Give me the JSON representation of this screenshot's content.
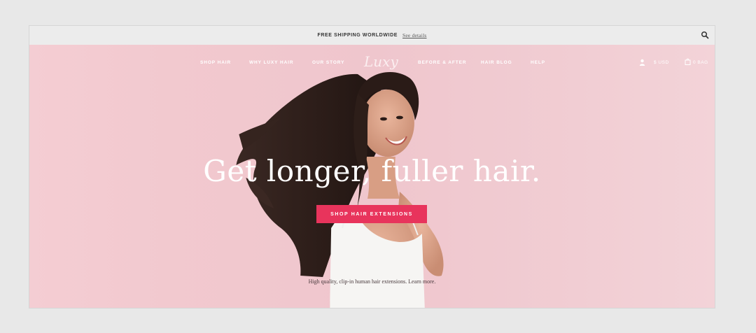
{
  "announcement": {
    "text": "FREE SHIPPING WORLDWIDE",
    "link": "See details"
  },
  "nav": {
    "items": [
      "SHOP HAIR",
      "WHY LUXY HAIR",
      "OUR STORY",
      "BEFORE & AFTER",
      "HAIR BLOG",
      "HELP"
    ],
    "logo": "Luxy",
    "currency": "$ USD",
    "bag": "0 BAG"
  },
  "hero": {
    "headline": "Get longer, fuller hair.",
    "cta": "SHOP HAIR EXTENSIONS",
    "subtext": "High quality, clip-in human hair extensions.",
    "learn_more": "Learn more."
  },
  "icons": {
    "search": "search-icon",
    "user": "user-icon",
    "bag": "shopping-bag-icon"
  },
  "colors": {
    "hero_background": "#f0c8ce",
    "cta_background": "#e8345c",
    "page_background": "#e8e8e8"
  }
}
